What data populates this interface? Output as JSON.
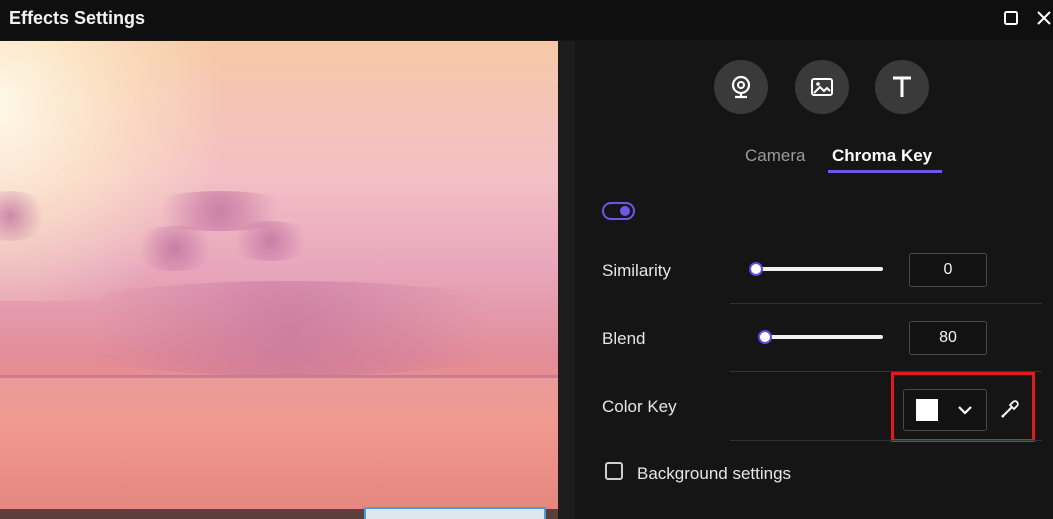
{
  "window": {
    "title": "Effects Settings"
  },
  "icons": {
    "maximize": "maximize-icon",
    "close": "close-icon",
    "camera": "webcam-icon",
    "image": "image-icon",
    "text": "text-icon",
    "dropdown": "chevron-down-icon",
    "eyedropper": "eyedropper-icon"
  },
  "tabs": [
    {
      "label": "Camera",
      "active": false
    },
    {
      "label": "Chroma Key",
      "active": true
    }
  ],
  "chroma_key": {
    "enabled": true,
    "similarity": {
      "label": "Similarity",
      "value": "0"
    },
    "blend": {
      "label": "Blend",
      "value": "80"
    },
    "color_key": {
      "label": "Color Key",
      "color": "#ffffff"
    },
    "background_settings": {
      "label": "Background settings",
      "checked": false
    }
  },
  "colors": {
    "accent": "#6e57e8",
    "highlight": "#e01b1b"
  }
}
